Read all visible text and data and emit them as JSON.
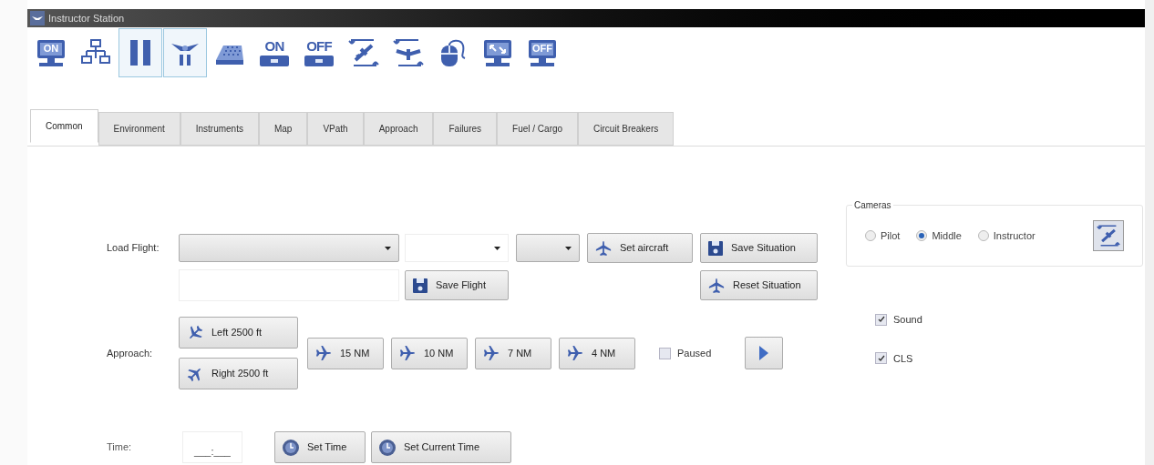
{
  "window": {
    "title": "Instructor Station"
  },
  "toolbar": [
    {
      "kind": "monitor",
      "label": "ON",
      "selected": false
    },
    {
      "kind": "network",
      "selected": false
    },
    {
      "kind": "pause",
      "selected": true
    },
    {
      "kind": "aircraft-pause",
      "selected": true
    },
    {
      "kind": "keyboard",
      "selected": false
    },
    {
      "kind": "drive",
      "label": "ON",
      "selected": false
    },
    {
      "kind": "drive",
      "label": "OFF",
      "selected": false
    },
    {
      "kind": "aircraft-swap",
      "selected": false
    },
    {
      "kind": "aircraft-swap-top",
      "selected": false
    },
    {
      "kind": "mouse",
      "selected": false
    },
    {
      "kind": "monitor-swap",
      "selected": false
    },
    {
      "kind": "monitor",
      "label": "OFF",
      "selected": false
    }
  ],
  "tabs": [
    {
      "label": "Common",
      "selected": true
    },
    {
      "label": "Environment",
      "selected": false
    },
    {
      "label": "Instruments",
      "selected": false
    },
    {
      "label": "Map",
      "selected": false
    },
    {
      "label": "VPath",
      "selected": false
    },
    {
      "label": "Approach",
      "selected": false
    },
    {
      "label": "Failures",
      "selected": false
    },
    {
      "label": "Fuel / Cargo",
      "selected": false
    },
    {
      "label": "Circuit Breakers",
      "selected": false
    }
  ],
  "load_flight": {
    "label": "Load Flight:",
    "set_aircraft": "Set aircraft",
    "save_situation": "Save Situation",
    "save_flight": "Save Flight",
    "reset_situation": "Reset Situation"
  },
  "approach": {
    "label": "Approach:",
    "left": "Left 2500 ft",
    "right": "Right 2500 ft",
    "distances": [
      "15 NM",
      "10 NM",
      "7 NM",
      "4 NM"
    ],
    "paused": {
      "label": "Paused",
      "checked": false
    }
  },
  "time": {
    "label": "Time:",
    "value": "___:___",
    "set_time": "Set Time",
    "set_current_time": "Set Current Time"
  },
  "cameras": {
    "title": "Cameras",
    "options": [
      {
        "label": "Pilot",
        "selected": false
      },
      {
        "label": "Middle",
        "selected": true
      },
      {
        "label": "Instructor",
        "selected": false
      }
    ]
  },
  "options": [
    {
      "label": "Sound",
      "checked": true
    },
    {
      "label": "CLS",
      "checked": true
    }
  ]
}
